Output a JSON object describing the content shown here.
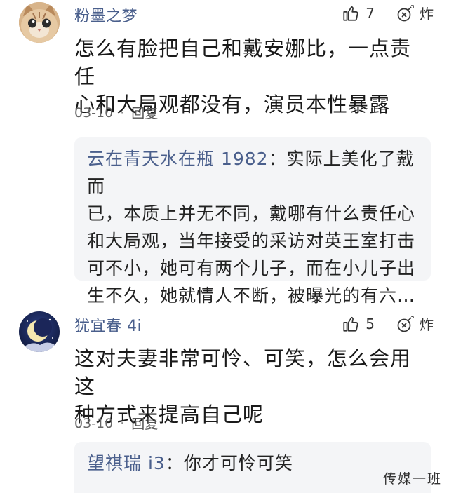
{
  "comments": [
    {
      "username": "粉墨之梦",
      "avatar_icon": "cat-avatar",
      "like_count": "7",
      "bomb_label": "炸",
      "body_lines": [
        "怎么有脸把自己和戴安娜比，一点责任",
        "心和大局观都没有，演员本性暴露"
      ],
      "date": "03-10",
      "separator": "·",
      "reply_label": "回复",
      "reply": {
        "author": "云在青天水在瓶 1982",
        "colon": "：",
        "lines": [
          "实际上美化了戴而",
          "已，本质上并无不同，戴哪有什么责任心",
          "和大局观，当年接受的采访对英王室打击",
          "可不小，她可有两个儿子，而在小儿子出",
          "生不久，她就情人不断，被曝光的有六…"
        ]
      }
    },
    {
      "username": "犹宜春 4i",
      "avatar_icon": "moon-avatar",
      "like_count": "5",
      "bomb_label": "炸",
      "body_lines": [
        "这对夫妻非常可怜、可笑，怎么会用这",
        "种方式来提高自己呢"
      ],
      "date": "03-10",
      "separator": "·",
      "reply_label": "回复",
      "reply": {
        "author": "望祺瑞 i3",
        "colon": "：",
        "lines": [
          "你才可怜可笑"
        ]
      }
    }
  ],
  "watermark": "传媒一班",
  "colors": {
    "username": "#4a5f8c",
    "reply_bg": "#f4f5f7",
    "body": "#1a1a1a"
  }
}
